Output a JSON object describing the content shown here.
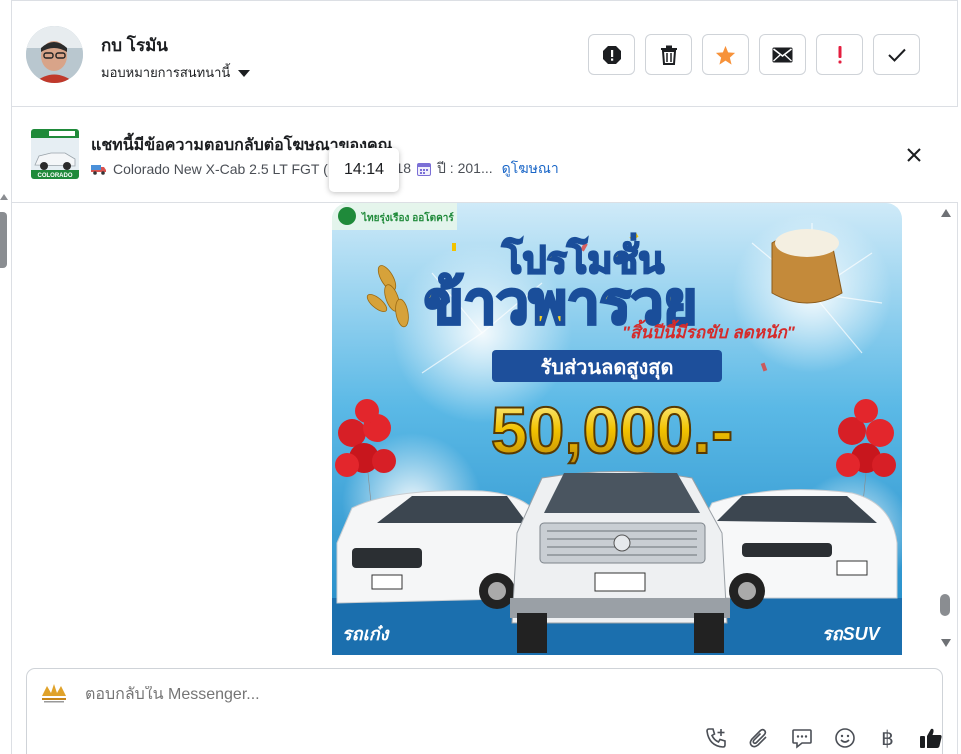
{
  "header": {
    "contact_name": "กบ โรมัน",
    "assign_label": "มอบหมายการสนทนานี้",
    "actions": [
      {
        "icon": "spam-icon",
        "label": "spam"
      },
      {
        "icon": "trash-icon",
        "label": "delete"
      },
      {
        "icon": "star-icon",
        "label": "star"
      },
      {
        "icon": "mail-icon",
        "label": "mark unread"
      },
      {
        "icon": "exclamation-icon",
        "label": "follow up"
      },
      {
        "icon": "check-icon",
        "label": "done"
      }
    ],
    "star_color": "#f7923a",
    "exclamation_color": "#e41e3f"
  },
  "ad_banner": {
    "title": "แชทนี้มีข้อความตอบกลับต่อโฆษณาของคุณ",
    "vehicle": "Colorado New X-Cab 2.5 LT FGT (",
    "year_text": "* ปี 2018",
    "year_text2": "ปี : 201...",
    "link": "ดูโฆษณา",
    "thumb_label": "COLORADO"
  },
  "tooltip": {
    "time": "14:14"
  },
  "promo_image": {
    "brand": "ไทยรุ่งเรือง ออโตคาร์",
    "headline_small": "โปรโมชั่น",
    "headline_big": "ข้าวพารวย",
    "tagline": "\"สิ้นปีนี้มีรถขับ ลดหนัก\"",
    "discount_label": "รับส่วนลดสูงสุด",
    "amount": "50,000.-",
    "tag_left": "รถเก๋ง",
    "tag_right": "รถSUV"
  },
  "composer": {
    "placeholder": "ตอบกลับใน Messenger...",
    "baht_symbol": "฿"
  },
  "colors": {
    "link": "#1a66c7",
    "border": "#cfd3d8",
    "sky": "#1f9bd7",
    "gold": "#f2c200"
  }
}
